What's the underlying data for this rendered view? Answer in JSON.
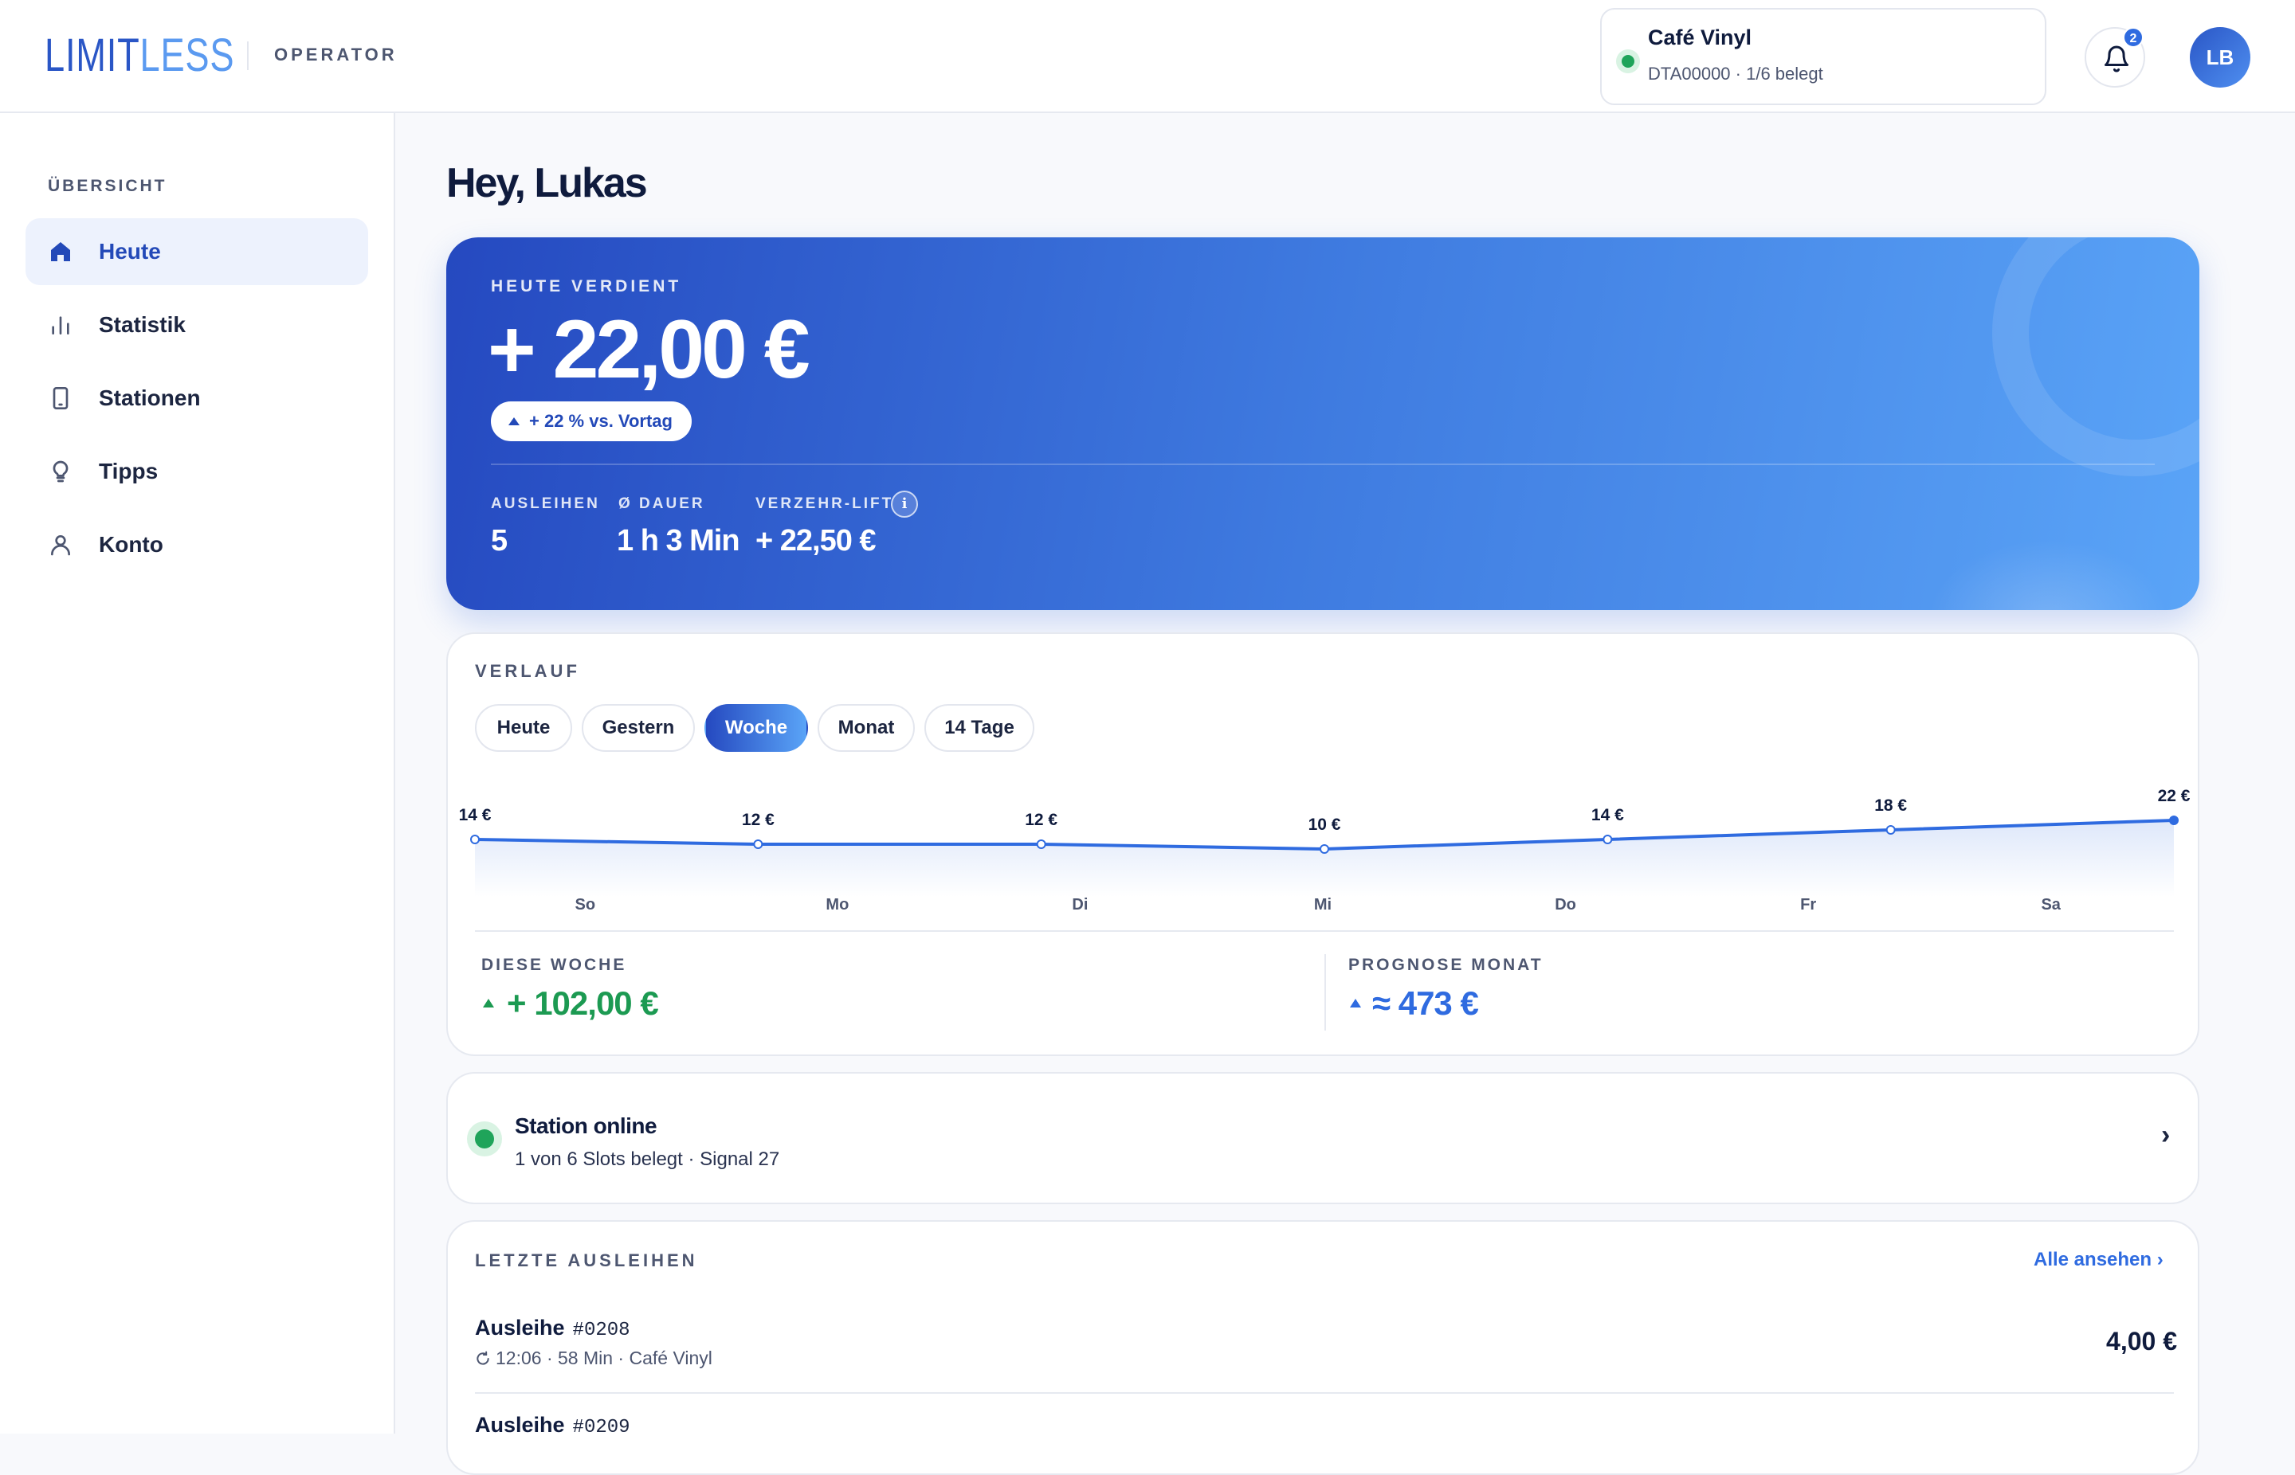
{
  "header": {
    "logo_lim": "LIMIT",
    "logo_less": "LESS",
    "role": "OPERATOR",
    "venue_name": "Café Vinyl",
    "venue_sub": "DTA00000 · 1/6 belegt",
    "notifications_count": "2",
    "avatar_initials": "LB"
  },
  "sidebar": {
    "heading": "ÜBERSICHT",
    "items": [
      {
        "label": "Heute",
        "icon": "home-icon",
        "active": true
      },
      {
        "label": "Statistik",
        "icon": "bar-chart-icon"
      },
      {
        "label": "Stationen",
        "icon": "device-icon"
      },
      {
        "label": "Tipps",
        "icon": "lightbulb-icon"
      },
      {
        "label": "Konto",
        "icon": "user-icon"
      }
    ]
  },
  "main": {
    "greeting": "Hey, Lukas",
    "hero": {
      "kicker": "HEUTE VERDIENT",
      "amount": "+ 22,00 €",
      "change": "+ 22 % vs. Vortag",
      "stats": [
        {
          "label": "AUSLEIHEN",
          "value": "5"
        },
        {
          "label": "Ø DAUER",
          "value": "1 h 3 Min"
        },
        {
          "label": "VERZEHR-LIFT",
          "value": "+ 22,50 €"
        }
      ],
      "info_glyph": "i"
    },
    "history": {
      "heading": "VERLAUF",
      "tabs": [
        "Heute",
        "Gestern",
        "Woche",
        "Monat",
        "14 Tage"
      ],
      "active_tab": "Woche",
      "week_label": "DIESE WOCHE",
      "week_value": "+ 102,00 €",
      "forecast_label": "PROGNOSE MONAT",
      "forecast_value": "≈ 473 €"
    },
    "station": {
      "title": "Station online",
      "subtitle": "1 von 6 Slots belegt · Signal 27",
      "chevron": "›"
    },
    "rentals": {
      "heading": "LETZTE AUSLEIHEN",
      "see_all": "Alle ansehen ›",
      "items": [
        {
          "title": "Ausleihe",
          "id": "#0208",
          "meta": "12:06 · 58 Min · Café Vinyl",
          "amount": "4,00 €"
        },
        {
          "title": "Ausleihe",
          "id": "#0209",
          "meta": "",
          "amount": ""
        }
      ]
    }
  },
  "chart_data": {
    "type": "line",
    "categories": [
      "So",
      "Mo",
      "Di",
      "Mi",
      "Do",
      "Fr",
      "Sa"
    ],
    "values": [
      14,
      12,
      12,
      10,
      14,
      18,
      22
    ],
    "point_labels": [
      "14 €",
      "12 €",
      "12 €",
      "10 €",
      "14 €",
      "18 €",
      "22 €"
    ],
    "series_color": "#2f6be0",
    "grid": false
  },
  "colors": {
    "accent": "#2f6be0",
    "accent_dark": "#2549c0",
    "positive": "#1c9a52",
    "online": "#1fa45a"
  }
}
